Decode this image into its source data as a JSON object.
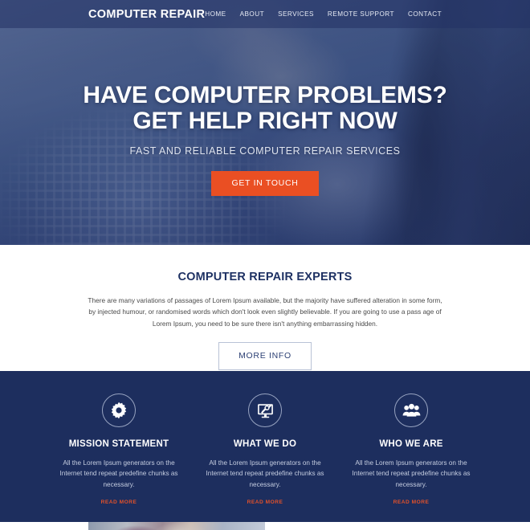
{
  "navbar": {
    "brand": "COMPUTER REPAIR",
    "links": [
      {
        "label": "HOME"
      },
      {
        "label": "ABOUT"
      },
      {
        "label": "SERVICES"
      },
      {
        "label": "REMOTE SUPPORT"
      },
      {
        "label": "CONTACT"
      }
    ]
  },
  "hero": {
    "title_line1": "HAVE COMPUTER PROBLEMS?",
    "title_line2": "GET HELP RIGHT NOW",
    "subtitle": "FAST AND RELIABLE COMPUTER REPAIR SERVICES",
    "cta_label": "GET IN TOUCH",
    "cta_color": "#ea4f23"
  },
  "experts": {
    "title": "COMPUTER REPAIR EXPERTS",
    "title_color": "#1e3163",
    "body": "There are many variations of passages of Lorem Ipsum available, but the majority have suffered alteration in some form, by injected humour, or randomised words which don't look even slightly believable. If you are going to use a pass age of Lorem Ipsum, you need to be sure there isn't anything embarrassing hidden.",
    "button_label": "MORE INFO"
  },
  "features": {
    "background_color": "#1d2e5e",
    "link_color": "#e2512a",
    "items": [
      {
        "icon": "gear-icon",
        "title": "MISSION STATEMENT",
        "text": "All the Lorem Ipsum generators on the Internet tend repeat predefine chunks as necessary.",
        "link_label": "READ MORE"
      },
      {
        "icon": "monitor-tools-icon",
        "title": "WHAT WE DO",
        "text": "All the Lorem Ipsum generators on the Internet tend repeat predefine chunks as necessary.",
        "link_label": "READ MORE"
      },
      {
        "icon": "users-group-icon",
        "title": "WHO WE ARE",
        "text": "All the Lorem Ipsum generators on the Internet tend repeat predefine chunks as necessary.",
        "link_label": "READ MORE"
      }
    ]
  }
}
